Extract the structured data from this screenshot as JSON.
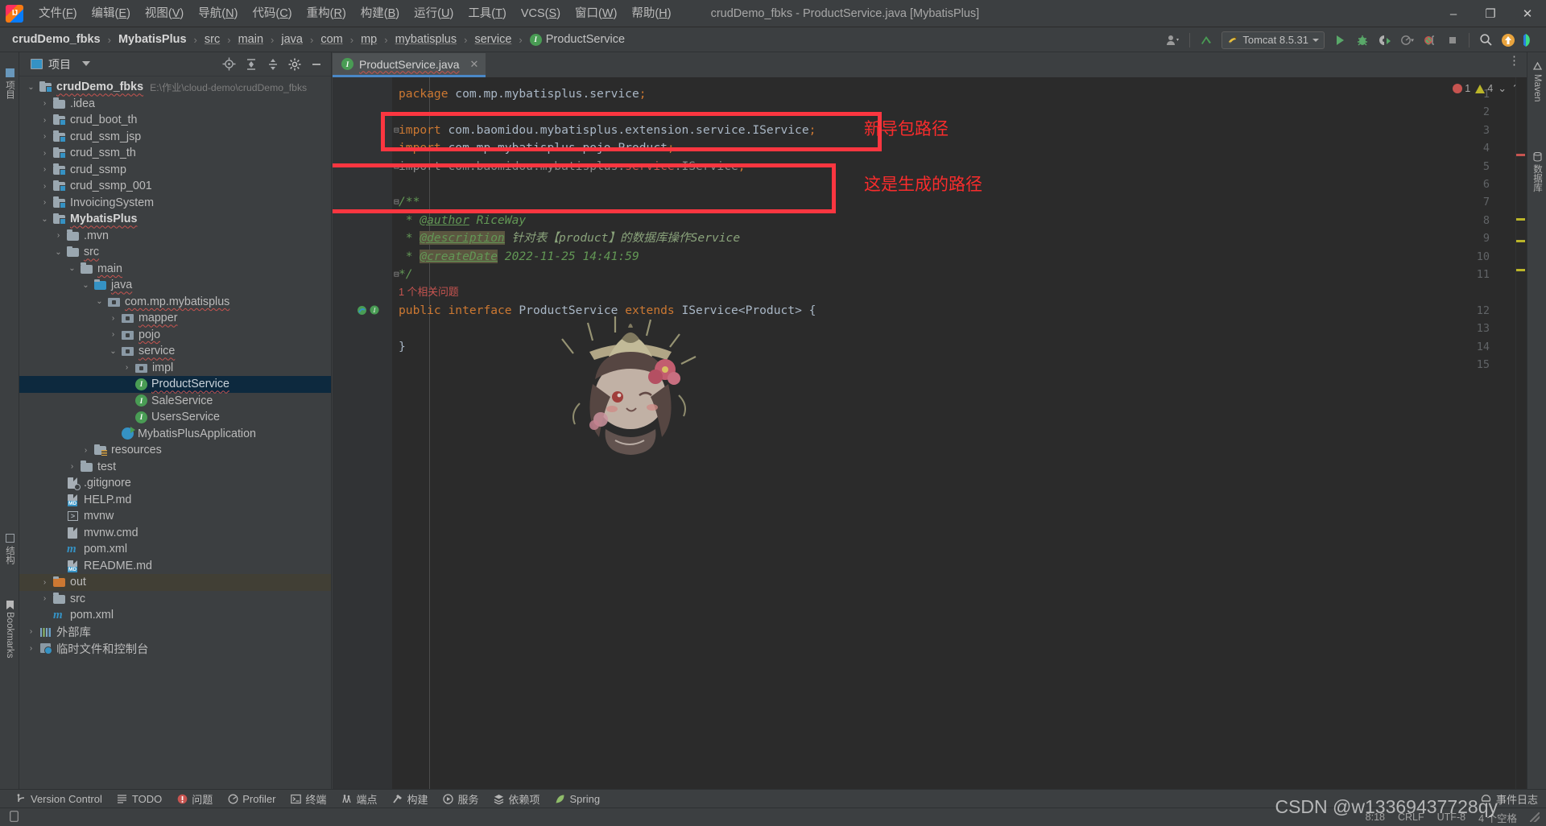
{
  "titlebar": {
    "logo": "intellij-idea-logo",
    "menus": [
      {
        "pre": "文件(",
        "accel": "F",
        "post": ")"
      },
      {
        "pre": "编辑(",
        "accel": "E",
        "post": ")"
      },
      {
        "pre": "视图(",
        "accel": "V",
        "post": ")"
      },
      {
        "pre": "导航(",
        "accel": "N",
        "post": ")"
      },
      {
        "pre": "代码(",
        "accel": "C",
        "post": ")"
      },
      {
        "pre": "重构(",
        "accel": "R",
        "post": ")"
      },
      {
        "pre": "构建(",
        "accel": "B",
        "post": ")"
      },
      {
        "pre": "运行(",
        "accel": "U",
        "post": ")"
      },
      {
        "pre": "工具(",
        "accel": "T",
        "post": ")"
      },
      {
        "pre": "VCS(",
        "accel": "S",
        "post": ")"
      },
      {
        "pre": "窗口(",
        "accel": "W",
        "post": ")"
      },
      {
        "pre": "帮助(",
        "accel": "H",
        "post": ")"
      }
    ],
    "window_title": "crudDemo_fbks - ProductService.java [MybatisPlus]",
    "minimize": "–",
    "maximize": "❐",
    "close": "✕"
  },
  "navbar": {
    "crumbs": [
      {
        "label": "crudDemo_fbks",
        "style": "bold"
      },
      {
        "label": "MybatisPlus",
        "style": "bold"
      },
      {
        "label": "src",
        "style": "link"
      },
      {
        "label": "main",
        "style": "link"
      },
      {
        "label": "java",
        "style": "link"
      },
      {
        "label": "com",
        "style": "link"
      },
      {
        "label": "mp",
        "style": "link"
      },
      {
        "label": "mybatisplus",
        "style": "link"
      },
      {
        "label": "service",
        "style": "link"
      },
      {
        "label": "ProductService",
        "style": "iface"
      }
    ],
    "separator": "›",
    "run_config": "Tomcat 8.5.31",
    "icons": [
      "user-avatar-icon",
      "updates-arrow-icon",
      "run-icon",
      "debug-icon",
      "run-coverage-icon",
      "profiler-icon",
      "stop-icon",
      "search-everywhere-icon",
      "update-project-icon",
      "settings-icon"
    ]
  },
  "rails": {
    "left": [
      {
        "label": "项目",
        "name": "project"
      },
      {
        "label": "结构",
        "name": "structure"
      },
      {
        "label": "Bookmarks",
        "name": "bookmarks"
      }
    ],
    "right": [
      {
        "label": "Maven",
        "name": "maven"
      },
      {
        "label": "数据库",
        "name": "database"
      }
    ]
  },
  "project_panel": {
    "title": "项目",
    "header_icons": [
      "locate-icon",
      "expand-all-icon",
      "collapse-all-icon",
      "settings-icon",
      "hide-icon"
    ],
    "tree": [
      {
        "indent": 0,
        "arrow": "down",
        "icon": "module-folder",
        "label": "crudDemo_fbks",
        "bold": true,
        "squiggle": true,
        "sub": "E:\\作业\\cloud-demo\\crudDemo_fbks"
      },
      {
        "indent": 1,
        "arrow": "right",
        "icon": "folder",
        "label": ".idea"
      },
      {
        "indent": 1,
        "arrow": "right",
        "icon": "module-folder",
        "label": "crud_boot_th"
      },
      {
        "indent": 1,
        "arrow": "right",
        "icon": "module-folder",
        "label": "crud_ssm_jsp"
      },
      {
        "indent": 1,
        "arrow": "right",
        "icon": "module-folder",
        "label": "crud_ssm_th"
      },
      {
        "indent": 1,
        "arrow": "right",
        "icon": "module-folder",
        "label": "crud_ssmp"
      },
      {
        "indent": 1,
        "arrow": "right",
        "icon": "module-folder",
        "label": "crud_ssmp_001"
      },
      {
        "indent": 1,
        "arrow": "right",
        "icon": "module-folder",
        "label": "InvoicingSystem"
      },
      {
        "indent": 1,
        "arrow": "down",
        "icon": "module-folder",
        "label": "MybatisPlus",
        "bold": true,
        "squiggle": true
      },
      {
        "indent": 2,
        "arrow": "right",
        "icon": "folder",
        "label": ".mvn"
      },
      {
        "indent": 2,
        "arrow": "down",
        "icon": "folder",
        "label": "src",
        "squiggle": true
      },
      {
        "indent": 3,
        "arrow": "down",
        "icon": "folder",
        "label": "main",
        "squiggle": true
      },
      {
        "indent": 4,
        "arrow": "down",
        "icon": "source-folder",
        "label": "java",
        "squiggle": true
      },
      {
        "indent": 5,
        "arrow": "down",
        "icon": "package",
        "label": "com.mp.mybatisplus",
        "squiggle": true
      },
      {
        "indent": 6,
        "arrow": "right",
        "icon": "package",
        "label": "mapper",
        "squiggle": true
      },
      {
        "indent": 6,
        "arrow": "right",
        "icon": "package",
        "label": "pojo",
        "squiggle": true
      },
      {
        "indent": 6,
        "arrow": "down",
        "icon": "package",
        "label": "service",
        "squiggle": true
      },
      {
        "indent": 7,
        "arrow": "right",
        "icon": "package",
        "label": "impl"
      },
      {
        "indent": 7,
        "arrow": "none",
        "icon": "interface",
        "label": "ProductService",
        "selected": true,
        "squiggle": true
      },
      {
        "indent": 7,
        "arrow": "none",
        "icon": "interface",
        "label": "SaleService"
      },
      {
        "indent": 7,
        "arrow": "none",
        "icon": "interface",
        "label": "UsersService"
      },
      {
        "indent": 6,
        "arrow": "none",
        "icon": "spring-boot-app",
        "label": "MybatisPlusApplication"
      },
      {
        "indent": 4,
        "arrow": "right",
        "icon": "resources-folder",
        "label": "resources"
      },
      {
        "indent": 3,
        "arrow": "right",
        "icon": "folder",
        "label": "test"
      },
      {
        "indent": 2,
        "arrow": "none",
        "icon": "gitignore-file",
        "label": ".gitignore"
      },
      {
        "indent": 2,
        "arrow": "none",
        "icon": "md-file",
        "label": "HELP.md"
      },
      {
        "indent": 2,
        "arrow": "none",
        "icon": "shell-file",
        "label": "mvnw"
      },
      {
        "indent": 2,
        "arrow": "none",
        "icon": "text-file",
        "label": "mvnw.cmd"
      },
      {
        "indent": 2,
        "arrow": "none",
        "icon": "maven-file",
        "label": "pom.xml"
      },
      {
        "indent": 2,
        "arrow": "none",
        "icon": "md-file",
        "label": "README.md"
      },
      {
        "indent": 1,
        "arrow": "right",
        "icon": "out-folder",
        "label": "out",
        "highlight": true
      },
      {
        "indent": 1,
        "arrow": "right",
        "icon": "folder",
        "label": "src"
      },
      {
        "indent": 1,
        "arrow": "none",
        "icon": "maven-file",
        "label": "pom.xml"
      },
      {
        "indent": 0,
        "arrow": "right",
        "icon": "library",
        "label": "外部库"
      },
      {
        "indent": 0,
        "arrow": "right",
        "icon": "scratches",
        "label": "临时文件和控制台"
      }
    ]
  },
  "editor": {
    "tab": {
      "label": "ProductService.java",
      "icon": "interface-icon",
      "close": "✕",
      "squiggle": true
    },
    "tab_menu_icon": "more-vertical-icon",
    "inspection": {
      "errors": "1",
      "warnings": "4",
      "collapse": "⌄",
      "expand": "⌃"
    },
    "lines": [
      {
        "n": "1",
        "segments": [
          {
            "t": "package ",
            "c": "k"
          },
          {
            "t": "com.mp.mybatisplus.service",
            "c": "pl"
          },
          {
            "t": ";",
            "c": "semi"
          }
        ]
      },
      {
        "n": "2",
        "segments": []
      },
      {
        "n": "3",
        "fold": "-",
        "segments": [
          {
            "t": "import ",
            "c": "k"
          },
          {
            "t": "com.baomidou.mybatisplus.extension.service.IService",
            "c": "pl"
          },
          {
            "t": ";",
            "c": "semi"
          }
        ]
      },
      {
        "n": "4",
        "segments": [
          {
            "t": "import ",
            "c": "k"
          },
          {
            "t": "com.mp.mybatisplus.pojo.Product",
            "c": "pl"
          },
          {
            "t": ";",
            "c": "semi"
          }
        ]
      },
      {
        "n": "5",
        "fold": "-",
        "segments": [
          {
            "t": "import ",
            "c": "dim"
          },
          {
            "t": "com.baomidou.mybatisplus.",
            "c": "dim"
          },
          {
            "t": "service",
            "c": "err"
          },
          {
            "t": ".IService",
            "c": "dim"
          },
          {
            "t": ";",
            "c": "semi"
          }
        ]
      },
      {
        "n": "6",
        "segments": []
      },
      {
        "n": "7",
        "fold": "-",
        "segments": [
          {
            "t": "/**",
            "c": "cm"
          }
        ]
      },
      {
        "n": "8",
        "segments": [
          {
            "t": " * ",
            "c": "cm"
          },
          {
            "t": "@author",
            "c": "tag"
          },
          {
            "t": " RiceWay",
            "c": "cm"
          }
        ]
      },
      {
        "n": "9",
        "segments": [
          {
            "t": " * ",
            "c": "cm"
          },
          {
            "t": "@description",
            "c": "tag taghl"
          },
          {
            "t": " 针对表【product】的数据库操作Service",
            "c": "cmtxt"
          }
        ]
      },
      {
        "n": "10",
        "segments": [
          {
            "t": " * ",
            "c": "cm"
          },
          {
            "t": "@createDate",
            "c": "tag taghl"
          },
          {
            "t": " 2022-11-25 14:41:59",
            "c": "cm"
          }
        ]
      },
      {
        "n": "11",
        "fold": "-",
        "segments": [
          {
            "t": "*/",
            "c": "cm"
          }
        ]
      },
      {
        "n": "12",
        "hint": "1 个相关问题",
        "gutter_icons": [
          "inherited-icon",
          "implemented-icon"
        ],
        "segments": [
          {
            "t": "public ",
            "c": "k"
          },
          {
            "t": "interface ",
            "c": "k"
          },
          {
            "t": "ProductService",
            "c": "cls"
          },
          {
            "t": " extends ",
            "c": "k"
          },
          {
            "t": "IService",
            "c": "cls"
          },
          {
            "t": "<",
            "c": "pl"
          },
          {
            "t": "Product",
            "c": "cls"
          },
          {
            "t": "> {",
            "c": "pl"
          }
        ]
      },
      {
        "n": "13",
        "segments": []
      },
      {
        "n": "14",
        "segments": [
          {
            "t": "}",
            "c": "pl"
          }
        ]
      },
      {
        "n": "15",
        "segments": []
      }
    ]
  },
  "annotations": [
    {
      "text": "新导包路径",
      "name": "annotation-new-import-path"
    },
    {
      "text": "这是生成的路径",
      "name": "annotation-generated-path"
    }
  ],
  "bottom_tools": [
    {
      "label": "Version Control",
      "icon": "branch-icon"
    },
    {
      "label": "TODO",
      "icon": "list-icon"
    },
    {
      "label": "问题",
      "icon": "error-circle-icon"
    },
    {
      "label": "Profiler",
      "icon": "profiler-icon"
    },
    {
      "label": "终端",
      "icon": "terminal-icon"
    },
    {
      "label": "端点",
      "icon": "endpoints-icon"
    },
    {
      "label": "构建",
      "icon": "hammer-icon"
    },
    {
      "label": "服务",
      "icon": "services-icon"
    },
    {
      "label": "依赖项",
      "icon": "dependencies-icon"
    },
    {
      "label": "Spring",
      "icon": "spring-leaf-icon"
    }
  ],
  "bottom_right_tool": {
    "label": "事件日志",
    "icon": "event-log-icon"
  },
  "statusbar": {
    "caret": "8:18",
    "line_separator": "CRLF",
    "encoding": "UTF-8",
    "indent": "4 个空格",
    "left_icon": "memory-indicator-icon"
  },
  "watermark": "CSDN @w13369437728qy",
  "colors": {
    "accent_blue": "#4a88c7",
    "annotation_red": "#fb3640",
    "selection": "#0d293e",
    "editor_bg": "#2b2b2b",
    "panel_bg": "#3c3f41",
    "interface_green": "#499c54"
  }
}
